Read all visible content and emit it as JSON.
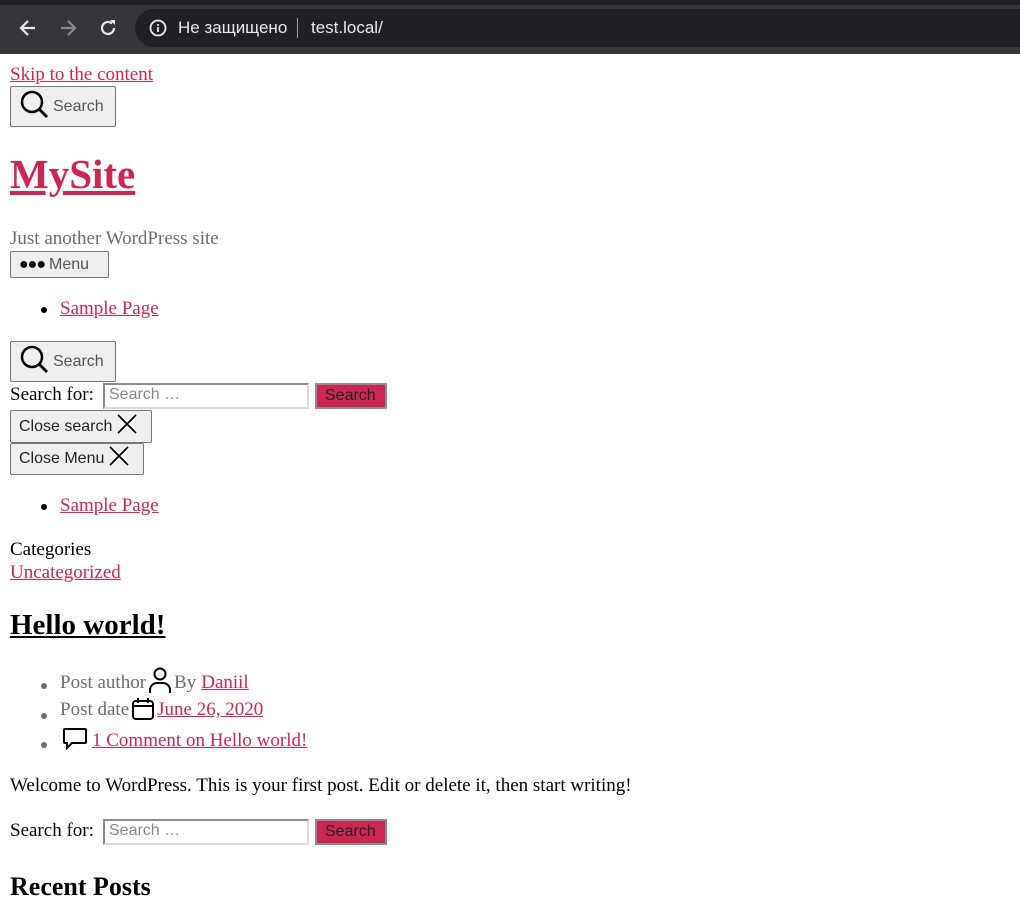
{
  "browser": {
    "security_label": "Не защищено",
    "url": "test.local/"
  },
  "page": {
    "skip_link": "Skip to the content",
    "search_toggle_label": "Search",
    "site_title": "MySite",
    "tagline": "Just another WordPress site",
    "menu_toggle_label": "Menu",
    "primary_nav": [
      "Sample Page"
    ],
    "search_form": {
      "label": "Search for:",
      "placeholder": "Search …",
      "submit": "Search"
    },
    "close_search_label": "Close search",
    "close_menu_label": "Close Menu",
    "modal_nav": [
      "Sample Page"
    ],
    "categories_label": "Categories",
    "category": "Uncategorized",
    "post": {
      "title": "Hello world!",
      "author_sr": "Post author",
      "author_prefix": "By",
      "author": "Daniil",
      "date_sr": "Post date",
      "date": "June 26, 2020",
      "comments": "1 Comment on Hello world!",
      "excerpt": "Welcome to WordPress. This is your first post. Edit or delete it, then start writing!"
    },
    "widget_search": {
      "label": "Search for:",
      "placeholder": "Search …",
      "submit": "Search"
    },
    "recent_posts_heading": "Recent Posts"
  },
  "colors": {
    "accent": "#cd2653",
    "chrome_bg": "#35363a",
    "omnibox_bg": "#202124"
  }
}
